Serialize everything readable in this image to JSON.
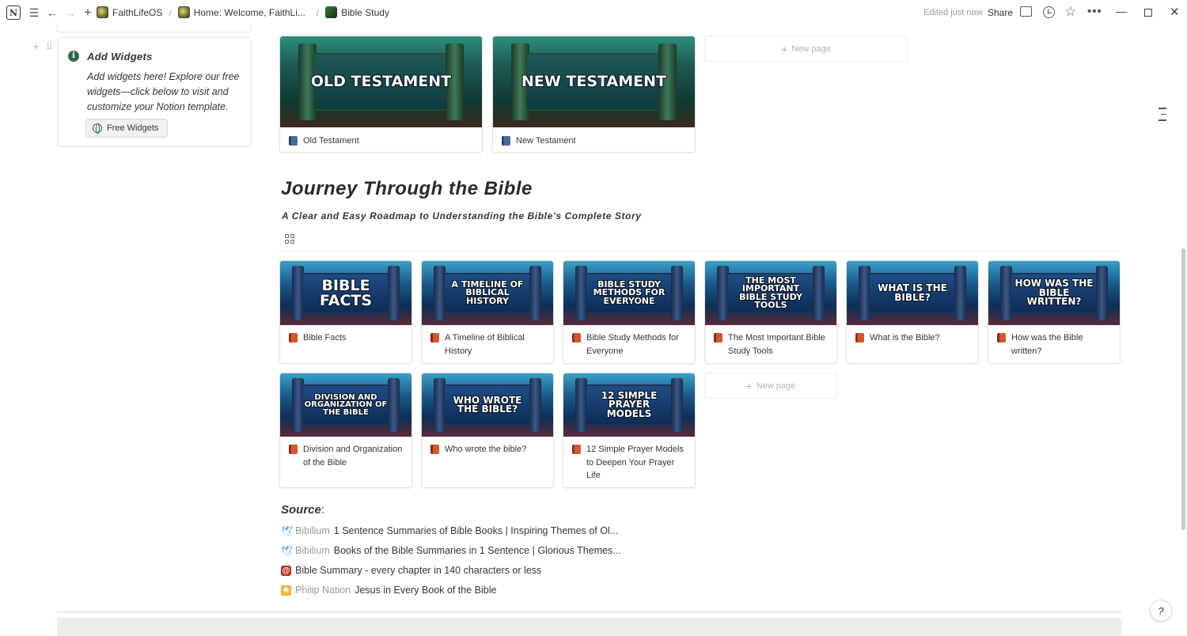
{
  "topbar": {
    "breadcrumbs": [
      {
        "label": "FaithLifeOS",
        "icon": "faithlife-logo-icon"
      },
      {
        "label": "Home: Welcome, FaithLi...",
        "icon": "faithlife-logo-icon"
      },
      {
        "label": "Bible Study",
        "icon": "bible-study-icon"
      }
    ],
    "edited": "Edited just now",
    "share": "Share"
  },
  "callout": {
    "title": "Add Widgets",
    "text": "Add widgets here! Explore our free widgets—click below to visit and customize your Notion template.",
    "button": "Free Widgets"
  },
  "testaments": [
    {
      "cover_text": "OLD TESTAMENT",
      "title": "Old Testament"
    },
    {
      "cover_text": "NEW TESTAMENT",
      "title": "New Testament"
    }
  ],
  "new_page_label": "New page",
  "journey": {
    "heading": "Journey Through the Bible",
    "subheading": "A Clear and Easy Roadmap to Understanding the Bible's Complete Story",
    "cards": [
      {
        "cover_text": "BIBLE FACTS",
        "title": "Bible Facts"
      },
      {
        "cover_text": "A TIMELINE OF BIBLICAL HISTORY",
        "title": "A Timeline of Biblical History"
      },
      {
        "cover_text": "BIBLE STUDY METHODS FOR EVERYONE",
        "title": "Bible Study Methods for Everyone"
      },
      {
        "cover_text": "THE MOST IMPORTANT BIBLE STUDY TOOLS",
        "title": "The Most Important Bible Study Tools"
      },
      {
        "cover_text": "WHAT IS THE BIBLE?",
        "title": "What is the Bible?"
      },
      {
        "cover_text": "HOW WAS THE BIBLE WRITTEN?",
        "title": "How was the Bible written?"
      },
      {
        "cover_text": "DIVISION AND ORGANIZATION OF THE BIBLE",
        "title": "Division and Organization of the Bible"
      },
      {
        "cover_text": "WHO WROTE THE BIBLE?",
        "title": "Who wrote the bible?"
      },
      {
        "cover_text": "12 SIMPLE PRAYER MODELS",
        "title": "12 Simple Prayer Models to Deepen Your Prayer Life"
      }
    ]
  },
  "sources": {
    "heading": "Source",
    "items": [
      {
        "site": "Bibilium",
        "text": "1 Sentence Summaries of Bible Books | Inspiring Themes of Ol...",
        "icon": "dove-icon"
      },
      {
        "site": "Bibilium",
        "text": "Books of the Bible Summaries in 1 Sentence | Glorious Themes...",
        "icon": "dove-icon"
      },
      {
        "site": "",
        "text": "Bible Summary - every chapter in 140 characters or less",
        "icon": "at-sign-icon"
      },
      {
        "site": "Philip Nation",
        "text": "Jesus in Every Book of the Bible",
        "icon": "sun-icon"
      }
    ]
  }
}
